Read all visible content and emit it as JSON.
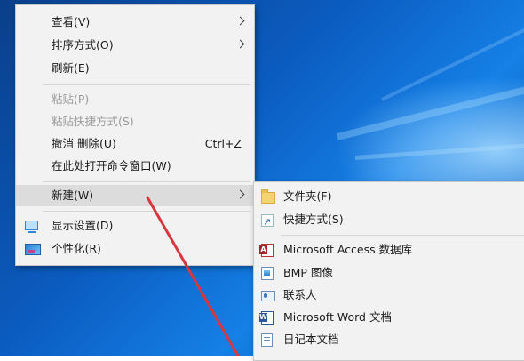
{
  "context_menu": {
    "items": [
      {
        "label": "查看(V)"
      },
      {
        "label": "排序方式(O)"
      },
      {
        "label": "刷新(E)"
      },
      {
        "label": "粘贴(P)"
      },
      {
        "label": "粘贴快捷方式(S)"
      },
      {
        "label": "撤消 删除(U)",
        "accelerator": "Ctrl+Z"
      },
      {
        "label": "在此处打开命令窗口(W)"
      },
      {
        "label": "新建(W)"
      },
      {
        "label": "显示设置(D)",
        "icon": "display-settings-icon"
      },
      {
        "label": "个性化(R)",
        "icon": "personalize-icon"
      }
    ]
  },
  "new_submenu": {
    "items": [
      {
        "label": "文件夹(F)",
        "icon": "folder-icon"
      },
      {
        "label": "快捷方式(S)",
        "icon": "shortcut-icon"
      },
      {
        "label": "Microsoft Access 数据库",
        "icon": "access-icon"
      },
      {
        "label": "BMP 图像",
        "icon": "bmp-image-icon"
      },
      {
        "label": "联系人",
        "icon": "contact-icon"
      },
      {
        "label": "Microsoft Word 文档",
        "icon": "word-icon"
      },
      {
        "label": "日记本文档",
        "icon": "journal-document-icon"
      }
    ]
  },
  "colors": {
    "menu_background": "#f2f2f2",
    "highlight": "#dcdcdc",
    "disabled_text": "#9a9a9a",
    "annotation_arrow": "#d9363e",
    "desktop_blue": "#0b5cc0"
  }
}
